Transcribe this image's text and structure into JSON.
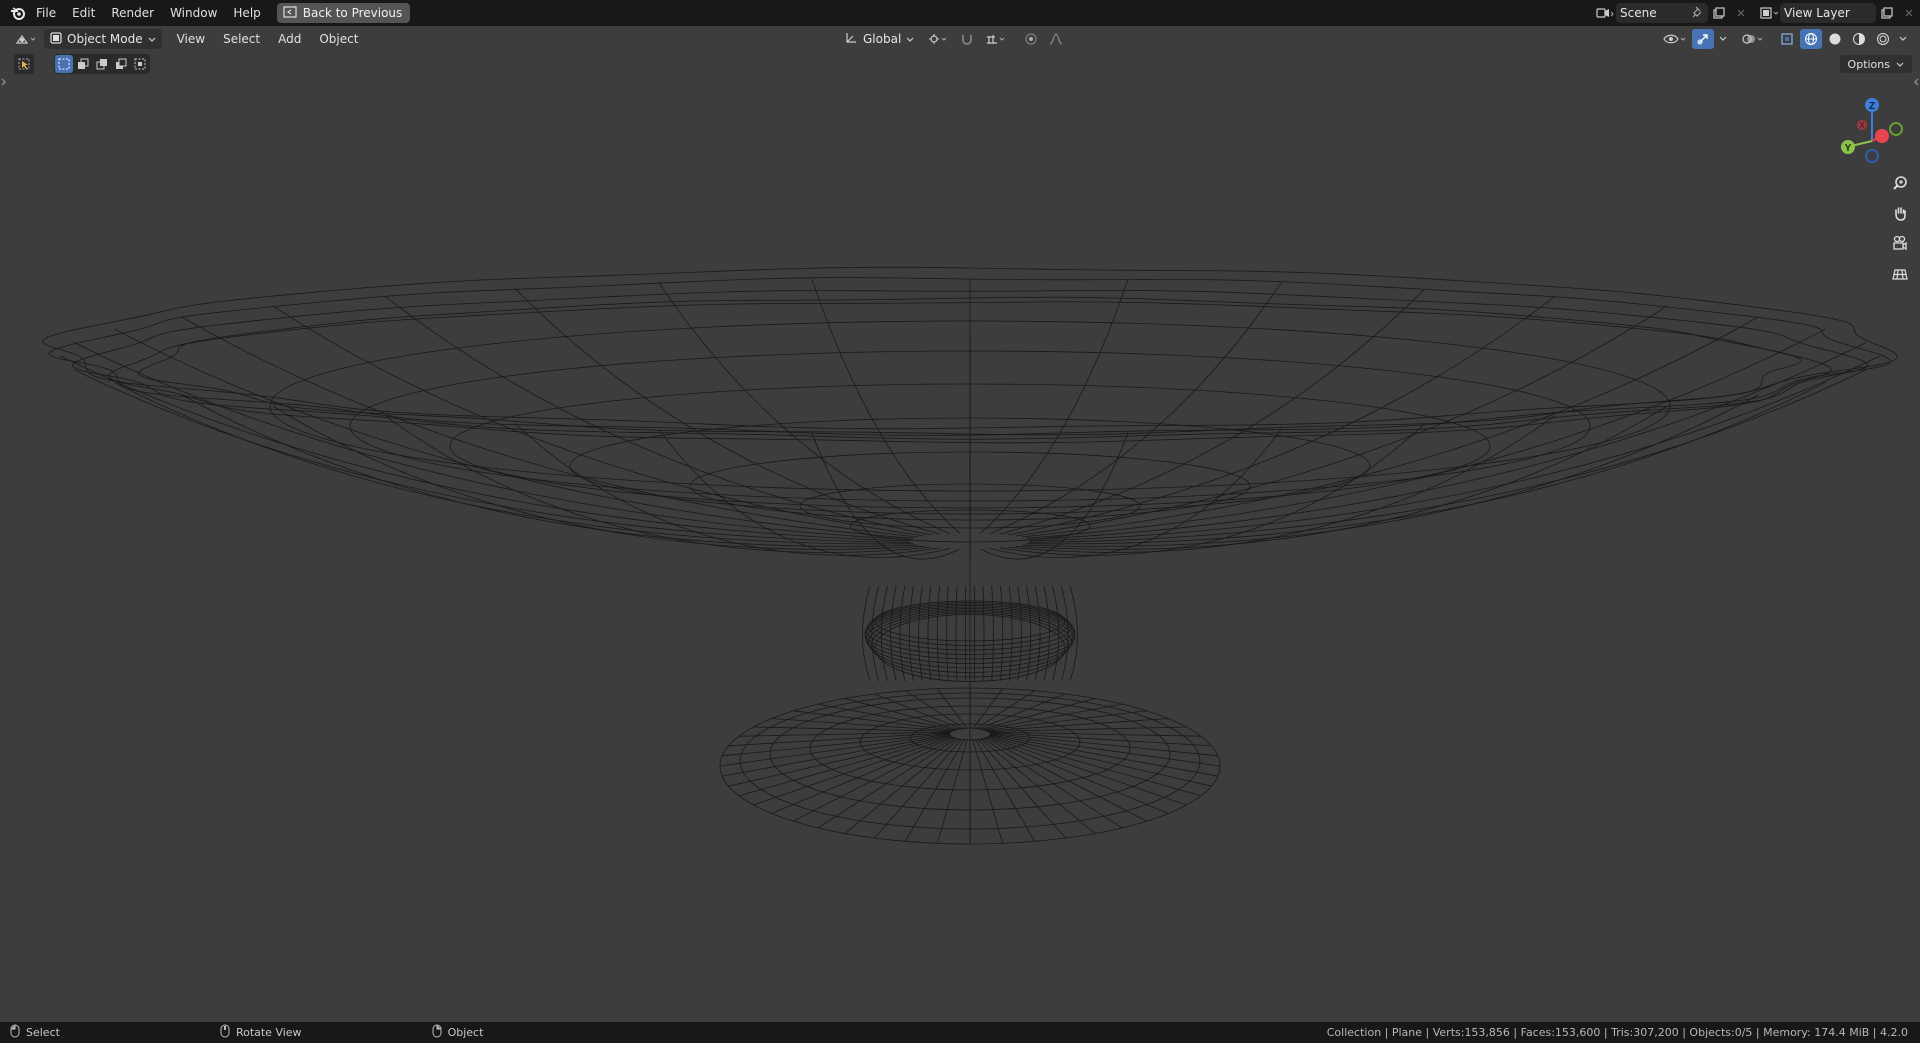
{
  "top_menu": {
    "items": [
      "File",
      "Edit",
      "Render",
      "Window",
      "Help"
    ],
    "back_button": "Back to Previous"
  },
  "top_right": {
    "scene_name": "Scene",
    "view_layer_name": "View Layer"
  },
  "viewport_header": {
    "mode": "Object Mode",
    "menus": [
      "View",
      "Select",
      "Add",
      "Object"
    ],
    "transform_orientation": "Global",
    "options_label": "Options"
  },
  "gizmo": {
    "axes": [
      "Z",
      "X",
      "Y"
    ],
    "colors": {
      "x": "#e8454f",
      "y": "#8bc34a",
      "z": "#3d7fdc"
    }
  },
  "status_bar": {
    "hints": [
      "Select",
      "Rotate View",
      "Object"
    ],
    "stats": "Collection | Plane | Verts:153,856 | Faces:153,600 | Tris:307,200 | Objects:0/5 | Memory: 174.4 MiB | 4.2.0"
  },
  "theme": {
    "accent": "#4772b3",
    "viewport_bg": "#3d3d3d",
    "wire_color": "#151515"
  }
}
